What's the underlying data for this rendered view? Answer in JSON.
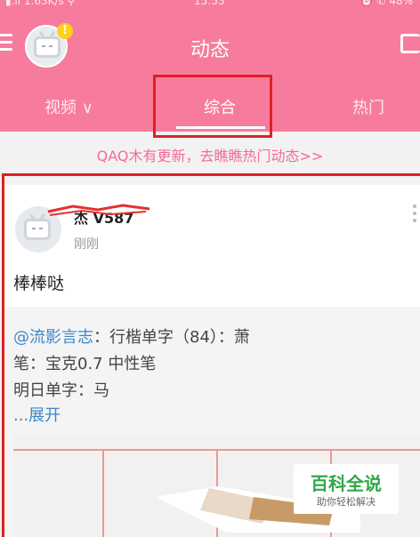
{
  "status_bar": {
    "left": "▮.ıl 1.63K/s ⚲",
    "center": "15:53",
    "right": "⏰ ✆ 48%"
  },
  "header": {
    "title": "动态",
    "tabs": [
      {
        "label": "视频 ∨"
      },
      {
        "label": "综合"
      },
      {
        "label": "热门"
      }
    ],
    "badge": "!"
  },
  "notice": "QAQ木有更新，去瞧瞧热门动态>>",
  "post": {
    "username": "杰 V587",
    "time": "刚刚",
    "text": "棒棒哒",
    "repost": {
      "mention": "@流影言志",
      "line1_rest": "：行楷单字（84）：萧",
      "line2": "笔：宝克0.7 中性笔",
      "line3": "明日单字：马",
      "expand": "...展开"
    }
  },
  "watermark": {
    "main": "百科全说",
    "sub": "助你轻松解决"
  },
  "colors": {
    "header_pink": "#f77b9c",
    "highlight_red": "#e02020",
    "link_blue": "#3d86c6",
    "notice_pink": "#f56b95"
  }
}
